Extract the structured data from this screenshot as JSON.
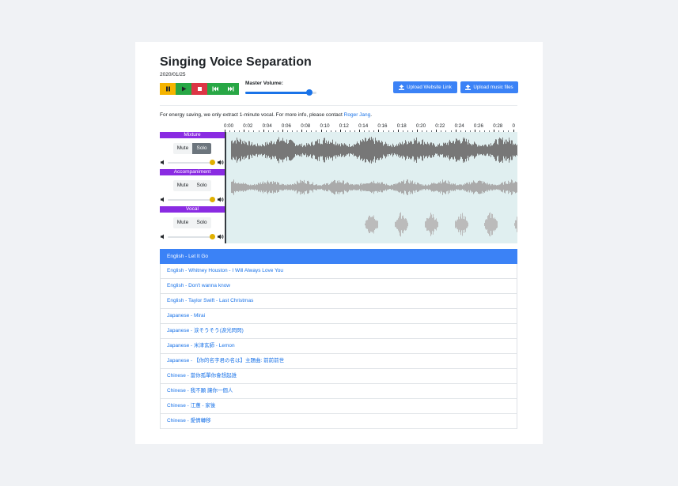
{
  "page": {
    "title": "Singing Voice Separation",
    "date": "2020/01/25"
  },
  "transport": {
    "buttons": [
      {
        "name": "pause-button",
        "icon": "pause-icon",
        "color": "#f5b400"
      },
      {
        "name": "play-button",
        "icon": "play-icon",
        "color": "#28a745"
      },
      {
        "name": "stop-button",
        "icon": "stop-icon",
        "color": "#dc3545"
      },
      {
        "name": "rewind-button",
        "icon": "skip-back-icon",
        "color": "#28a745"
      },
      {
        "name": "forward-button",
        "icon": "skip-forward-icon",
        "color": "#28a745"
      }
    ]
  },
  "master_volume": {
    "label": "Master Volume:",
    "level": 0.9
  },
  "uploads": {
    "website_link": "Upload Website Link",
    "music_files": "Upload music files"
  },
  "note": {
    "text": "For energy saving, we only extract 1-minute vocal. For more info, please contact ",
    "link": "Roger Jang",
    "suffix": "."
  },
  "timeline": {
    "ticks": [
      "0:00",
      "0:02",
      "0:04",
      "0:06",
      "0:08",
      "0:10",
      "0:12",
      "0:14",
      "0:16",
      "0:18",
      "0:20",
      "0:22",
      "0:24",
      "0:26",
      "0:28",
      "0"
    ]
  },
  "tracks": [
    {
      "name": "Mixture",
      "mute": "Mute",
      "solo": "Solo",
      "solo_active": true,
      "volume": 1.0
    },
    {
      "name": "Accompaniment",
      "mute": "Mute",
      "solo": "Solo",
      "solo_active": false,
      "volume": 1.0
    },
    {
      "name": "Vocal",
      "mute": "Mute",
      "solo": "Solo",
      "solo_active": false,
      "volume": 1.0
    }
  ],
  "songs": [
    "English - Let It Go",
    "English - Whitney Houston - I Will Always Love You",
    "English - Don't wanna know",
    "English - Taylor Swift - Last Christmas",
    "Japanese - Mirai",
    "Japanese - 涙そうそう(淚光閃閃)",
    "Japanese - 米津玄師 - Lemon",
    "Japanese - 【你的名字君の名は】主題曲: 前前前世",
    "Chinese - 當你孤單你會想起誰",
    "Chinese - 我不願 讓你一個人",
    "Chinese - 江蕙 - 家後",
    "Chinese - 愛情轉移"
  ],
  "active_song_index": 0,
  "colors": {
    "accent": "#3b82f6",
    "track_label": "#8a2be2",
    "waveform_bg": "#e0eff0",
    "mixture_wave": "#777777",
    "accompaniment_wave": "#aaaaaa",
    "vocal_wave": "#bbbbbb"
  }
}
